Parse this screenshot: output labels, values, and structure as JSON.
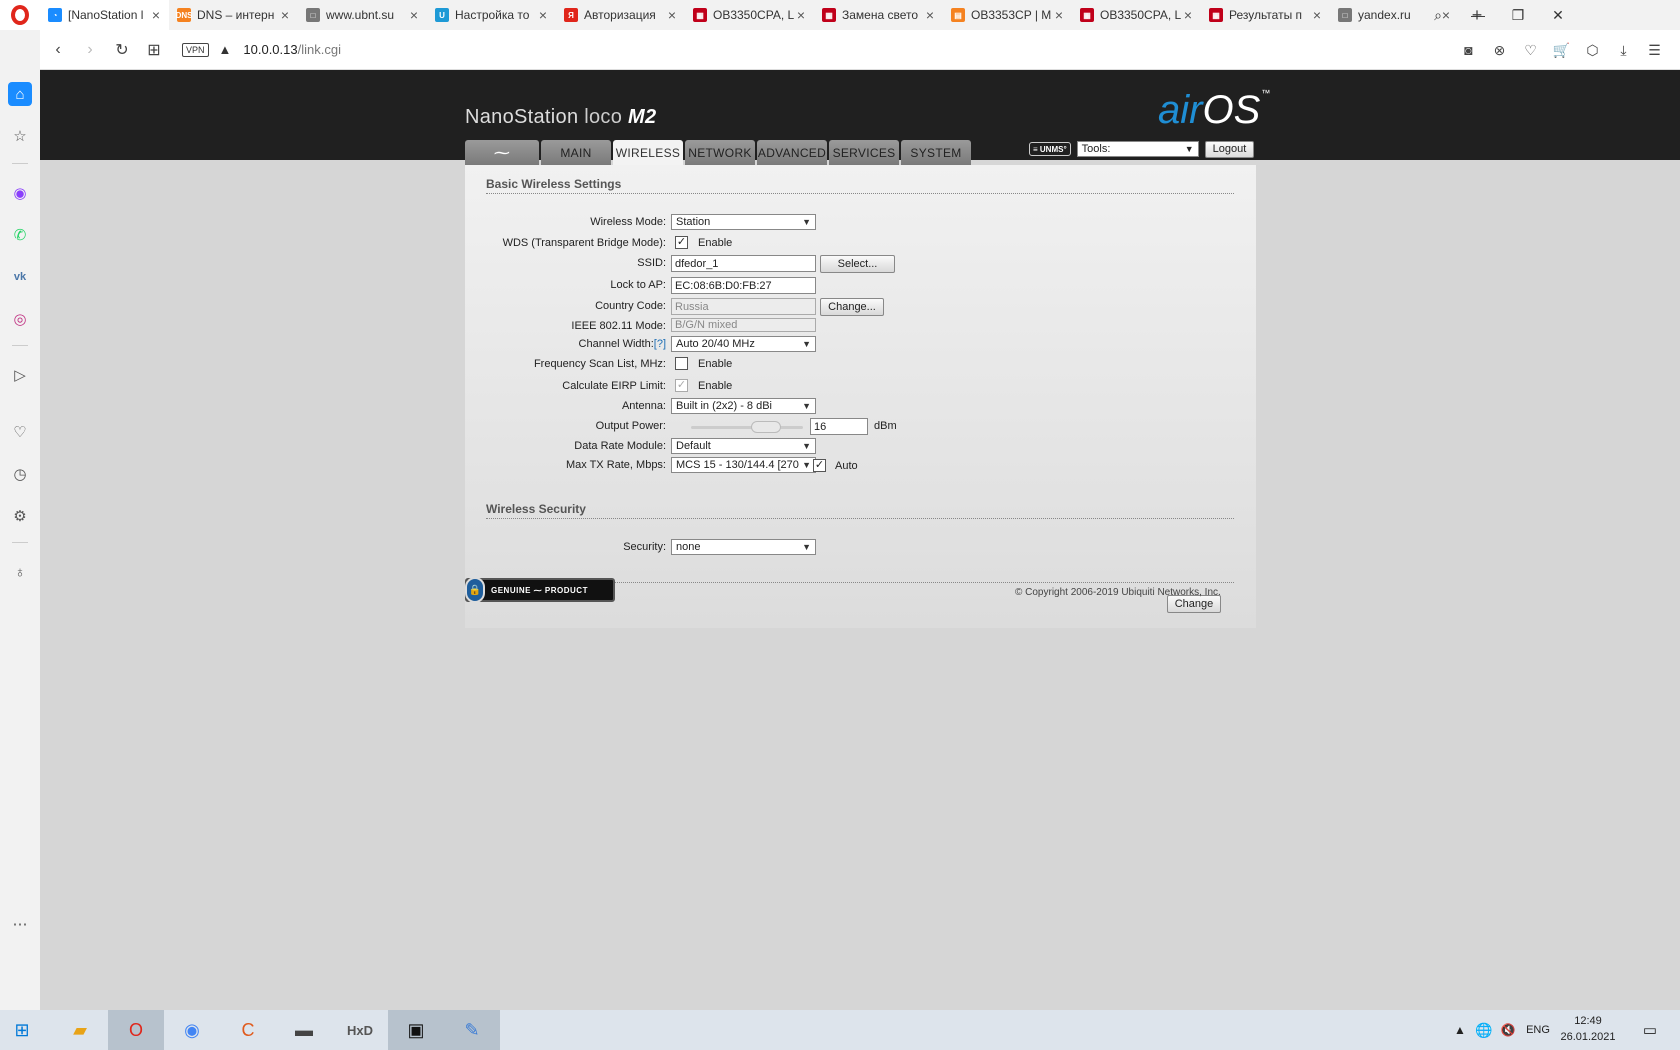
{
  "browser": {
    "tabs": [
      {
        "title": "[NanoStation l",
        "color": "#1a8cff",
        "glyph": "◔",
        "active": true
      },
      {
        "title": "DNS – интерн",
        "color": "#f58220",
        "glyph": "DNS",
        "active": false
      },
      {
        "title": "www.ubnt.su",
        "color": "#777777",
        "glyph": "□",
        "active": false
      },
      {
        "title": "Настройка то",
        "color": "#1e9ad6",
        "glyph": "U",
        "active": false
      },
      {
        "title": "Авторизация",
        "color": "#e0261b",
        "glyph": "Я",
        "active": false
      },
      {
        "title": "OB3350CPA, L",
        "color": "#c0001a",
        "glyph": "▦",
        "active": false
      },
      {
        "title": "Замена свето",
        "color": "#c0001a",
        "glyph": "▦",
        "active": false
      },
      {
        "title": "OB3353CP | M",
        "color": "#f58220",
        "glyph": "▤",
        "active": false
      },
      {
        "title": "OB3350CPA, L",
        "color": "#c0001a",
        "glyph": "▦",
        "active": false
      },
      {
        "title": "Результаты п",
        "color": "#c0001a",
        "glyph": "▦",
        "active": false
      },
      {
        "title": "yandex.ru",
        "color": "#777777",
        "glyph": "□",
        "active": false
      }
    ],
    "new_tab": "+",
    "vpn_label": "VPN",
    "url_host": "10.0.0.13",
    "url_path": "/link.cgi"
  },
  "airos": {
    "brand_name": "NanoStation",
    "brand_loco": "loco",
    "brand_model": "M2",
    "logo_air": "air",
    "logo_os": "OS",
    "logo_tm": "™",
    "tabs": {
      "logo": "⁓",
      "main": "MAIN",
      "wireless": "WIRELESS",
      "network": "NETWORK",
      "advanced": "ADVANCED",
      "services": "SERVICES",
      "system": "SYSTEM"
    },
    "unms": "≡ UNMS°",
    "tools_value": "Tools:",
    "logout": "Logout"
  },
  "basic": {
    "title": "Basic Wireless Settings",
    "wireless_mode": {
      "label": "Wireless Mode:",
      "value": "Station"
    },
    "wds": {
      "label": "WDS (Transparent Bridge Mode):",
      "checked": true,
      "text": "Enable"
    },
    "ssid": {
      "label": "SSID:",
      "value": "dfedor_1",
      "button": "Select..."
    },
    "lock_ap": {
      "label": "Lock to AP:",
      "value": "EC:08:6B:D0:FB:27"
    },
    "country": {
      "label": "Country Code:",
      "value": "Russia",
      "button": "Change..."
    },
    "ieee": {
      "label": "IEEE 802.11 Mode:",
      "value": "B/G/N mixed"
    },
    "channel_width": {
      "label": "Channel Width:",
      "help": "[?]",
      "value": "Auto 20/40 MHz"
    },
    "freq_scan": {
      "label": "Frequency Scan List, MHz:",
      "checked": false,
      "text": "Enable"
    },
    "eirp": {
      "label": "Calculate EIRP Limit:",
      "checked": true,
      "text": "Enable"
    },
    "antenna": {
      "label": "Antenna:",
      "value": "Built in (2x2) - 8 dBi"
    },
    "output_power": {
      "label": "Output Power:",
      "value": "16",
      "unit": "dBm"
    },
    "data_rate": {
      "label": "Data Rate Module:",
      "value": "Default"
    },
    "max_tx": {
      "label": "Max TX Rate, Mbps:",
      "value": "MCS 15 - 130/144.4 [270",
      "auto_checked": true,
      "auto_text": "Auto"
    }
  },
  "security": {
    "title": "Wireless Security",
    "label": "Security:",
    "value": "none"
  },
  "change_button": "Change",
  "genuine": "GENUINE ⁓ PRODUCT",
  "copyright": "© Copyright 2006-2019 Ubiquiti Networks, Inc.",
  "taskbar": {
    "lang": "ENG",
    "time": "12:49",
    "date": "26.01.2021"
  }
}
